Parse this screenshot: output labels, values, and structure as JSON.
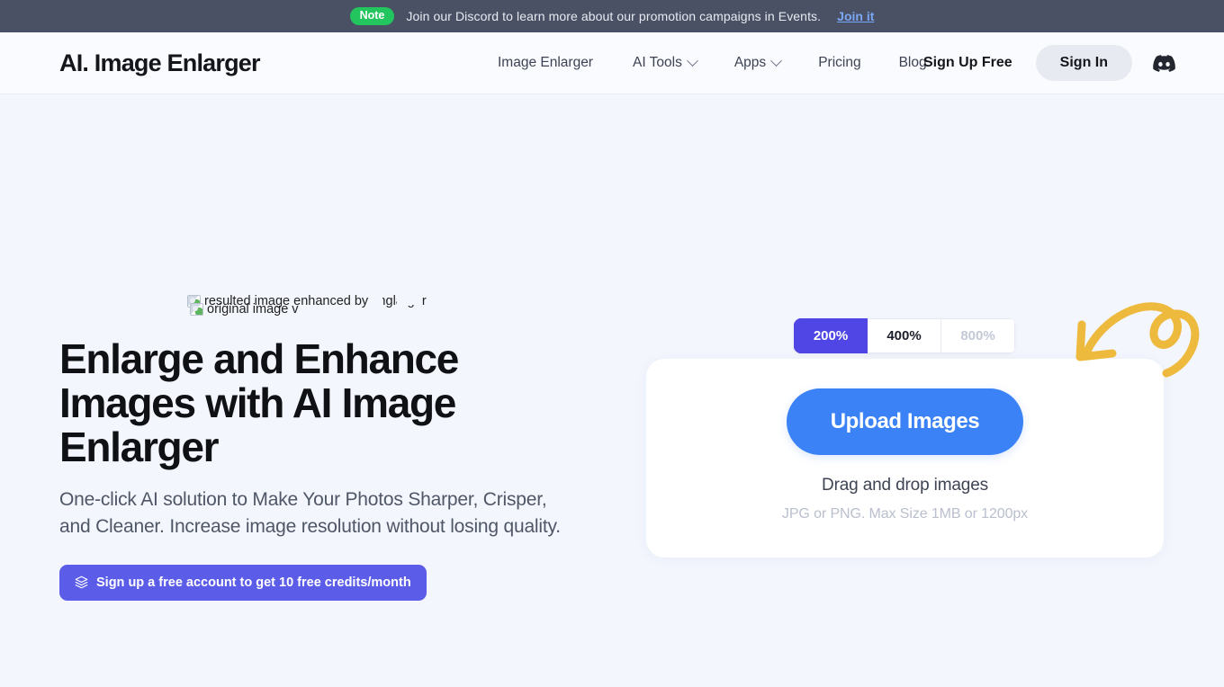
{
  "notice": {
    "badge": "Note",
    "text": "Join our Discord to learn more about our promotion campaigns in Events.",
    "link": "Join it"
  },
  "header": {
    "logo": "AI. Image Enlarger",
    "nav": [
      {
        "label": "Image Enlarger",
        "has_dropdown": false
      },
      {
        "label": "AI Tools",
        "has_dropdown": true
      },
      {
        "label": "Apps",
        "has_dropdown": true
      },
      {
        "label": "Pricing",
        "has_dropdown": false
      },
      {
        "label": "Blog",
        "has_dropdown": false
      }
    ],
    "sign_up_free": "Sign Up Free",
    "sign_in": "Sign In",
    "discord_icon": "discord-icon"
  },
  "hero": {
    "broken_images": [
      {
        "alt": "resulted image enhanced by imglarger",
        "icon": "broken-image-icon"
      },
      {
        "alt": "original image v",
        "icon": "broken-image-icon"
      }
    ],
    "heading": "Enlarge and Enhance Images with AI Image Enlarger",
    "subheading": "One-click AI solution to Make Your Photos Sharper, Crisper, and Cleaner. Increase image resolution without losing quality.",
    "credits_button": "Sign up a free account to get 10 free credits/month",
    "credits_button_icon": "layers-icon"
  },
  "uploader": {
    "scales": [
      {
        "label": "200%",
        "state": "active"
      },
      {
        "label": "400%",
        "state": "default"
      },
      {
        "label": "800%",
        "state": "disabled"
      }
    ],
    "upload_button": "Upload Images",
    "drag_text": "Drag and drop images",
    "hint_text": "JPG or PNG. Max Size 1MB or 1200px",
    "arrow_icon": "curved-arrow-icon"
  },
  "colors": {
    "notice_bar_bg": "#4a5164",
    "note_badge": "#22c55e",
    "notice_link": "#7aa7f5",
    "page_bg": "#f3f6fd",
    "header_bg": "#fafbfe",
    "accent_indigo": "#4f46e5",
    "credits_button": "#5b5ce8",
    "upload_button": "#3b82f6",
    "arrow_yellow": "#edba3e",
    "heading_text": "#101114",
    "body_text": "#4f5666"
  }
}
